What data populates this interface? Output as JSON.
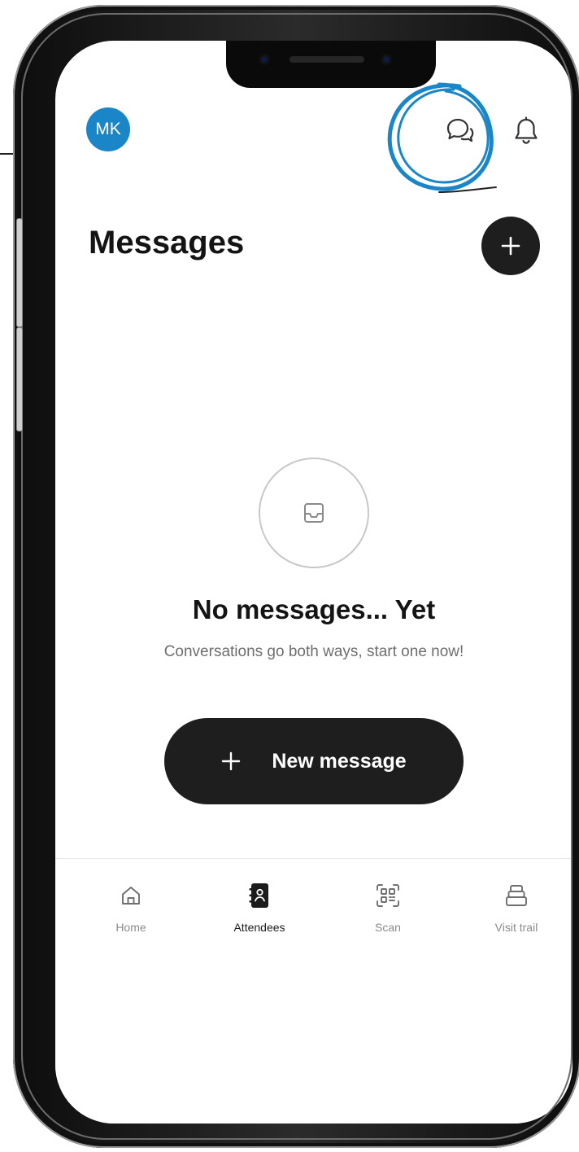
{
  "user": {
    "initials": "MK"
  },
  "colors": {
    "avatar": "#1a86c8",
    "annotation": "#1a86c8",
    "primary": "#1e1e1e",
    "muted_text": "#6e6e6e"
  },
  "header": {
    "icons": [
      "chat-bubbles-icon",
      "bell-icon"
    ]
  },
  "page": {
    "title": "Messages",
    "add_icon": "plus-icon"
  },
  "empty_state": {
    "icon": "inbox-icon",
    "title": "No messages... Yet",
    "subtitle": "Conversations go both ways, start one now!",
    "button_label": "New message",
    "button_icon": "plus-icon"
  },
  "nav": {
    "items": [
      {
        "label": "Home",
        "icon": "home-icon",
        "active": false
      },
      {
        "label": "Attendees",
        "icon": "contact-book-icon",
        "active": true
      },
      {
        "label": "Scan",
        "icon": "qr-scan-icon",
        "active": false
      },
      {
        "label": "Visit trail",
        "icon": "tray-stack-icon",
        "active": false
      }
    ]
  }
}
